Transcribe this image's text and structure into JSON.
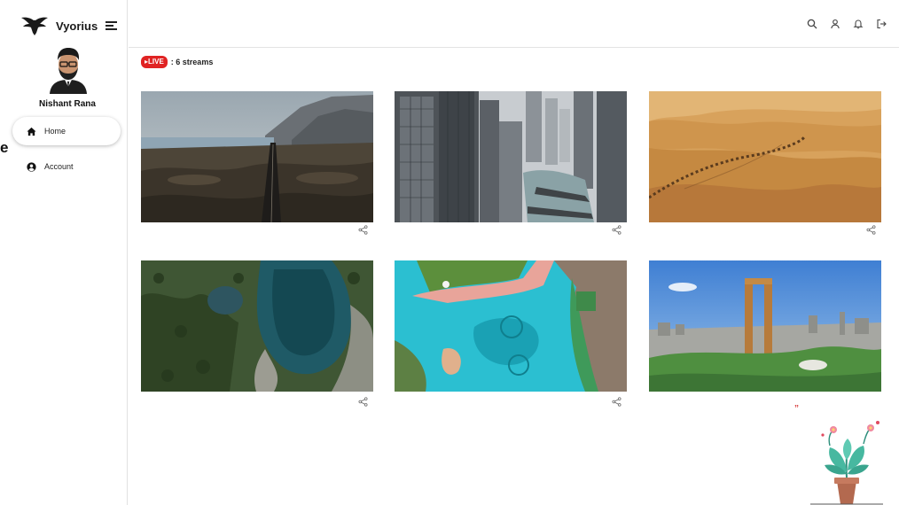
{
  "brand": {
    "name": "Vyorius",
    "logo_icon": "eagle-logo-icon",
    "menu_icon": "menu-toggle-icon"
  },
  "user": {
    "name": "Nishant Rana"
  },
  "sidebar": {
    "items": [
      {
        "label": "Home",
        "icon": "home-icon",
        "active": true
      },
      {
        "label": "Account",
        "icon": "account-icon",
        "active": false
      }
    ],
    "cut_off_text": "e"
  },
  "header": {
    "icons": [
      "search-icon",
      "user-icon",
      "bell-icon",
      "logout-icon"
    ]
  },
  "live": {
    "badge": "▸LIVE",
    "count_text": ": 6 streams",
    "badge_color": "#e02323"
  },
  "streams": [
    {
      "scene": "aerial road through desert landscape with mountains",
      "share_icon": "share-icon"
    },
    {
      "scene": "aerial city skyscrapers and river",
      "share_icon": "share-icon"
    },
    {
      "scene": "desert dunes with camel caravan",
      "share_icon": "share-icon"
    },
    {
      "scene": "forest with blue lake",
      "share_icon": "share-icon"
    },
    {
      "scene": "aerial fountain and pool",
      "share_icon": "share-icon"
    },
    {
      "scene": "dubai frame city skyline",
      "share_icon": ""
    }
  ],
  "decorations": {
    "stray_mark": "”",
    "plant": "potted-plant-illustration"
  }
}
